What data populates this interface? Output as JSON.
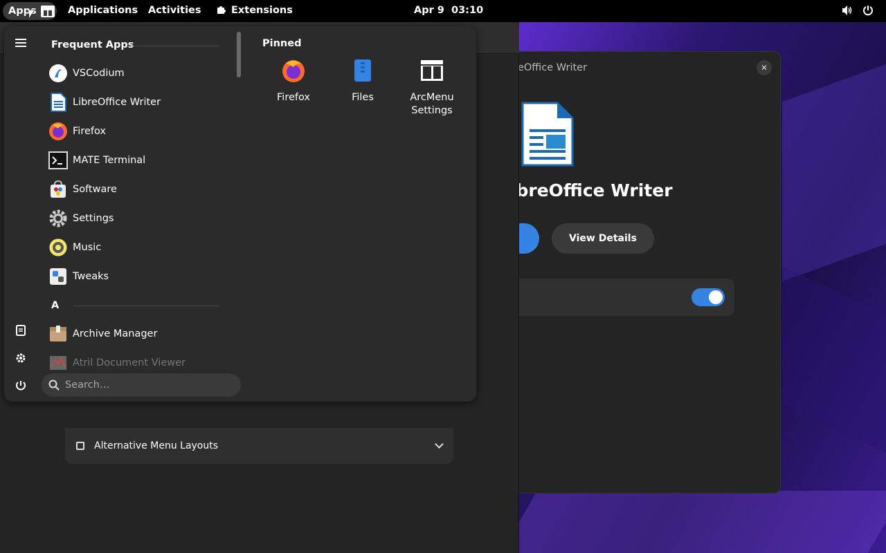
{
  "topbar": {
    "apps_label": "Apps",
    "applications_label": "Applications",
    "activities_label": "Activities",
    "extensions_label": "Extensions",
    "date": "Apr 9",
    "time": "03:10"
  },
  "background_window": {
    "row_label": "Alternative Menu Layouts"
  },
  "software_window": {
    "title": "LibreOffice Writer",
    "app_name": "LibreOffice Writer",
    "details_label": "View Details",
    "toggle_on": true
  },
  "arcmenu": {
    "frequent_title": "Frequent Apps",
    "frequent_apps": [
      {
        "label": "VSCodium",
        "icon": "vscodium-icon"
      },
      {
        "label": "LibreOffice Writer",
        "icon": "libreoffice-writer-icon"
      },
      {
        "label": "Firefox",
        "icon": "firefox-icon"
      },
      {
        "label": "MATE Terminal",
        "icon": "terminal-icon"
      },
      {
        "label": "Software",
        "icon": "software-icon"
      },
      {
        "label": "Settings",
        "icon": "settings-gear-icon"
      },
      {
        "label": "Music",
        "icon": "music-icon"
      },
      {
        "label": "Tweaks",
        "icon": "tweaks-icon"
      }
    ],
    "section_a": "A",
    "a_apps": [
      {
        "label": "Archive Manager",
        "icon": "archive-manager-icon"
      },
      {
        "label": "Atril Document Viewer",
        "icon": "atril-icon"
      }
    ],
    "pinned_title": "Pinned",
    "pinned": [
      {
        "label": "Firefox",
        "icon": "firefox-icon"
      },
      {
        "label": "Files",
        "icon": "files-icon"
      },
      {
        "label_line1": "ArcMenu",
        "label_line2": "Settings",
        "icon": "arcmenu-settings-icon"
      }
    ],
    "search_placeholder": "Search…"
  },
  "colors": {
    "accent": "#3584e4",
    "panel": "#2b2b2b",
    "topbar": "#000000"
  }
}
